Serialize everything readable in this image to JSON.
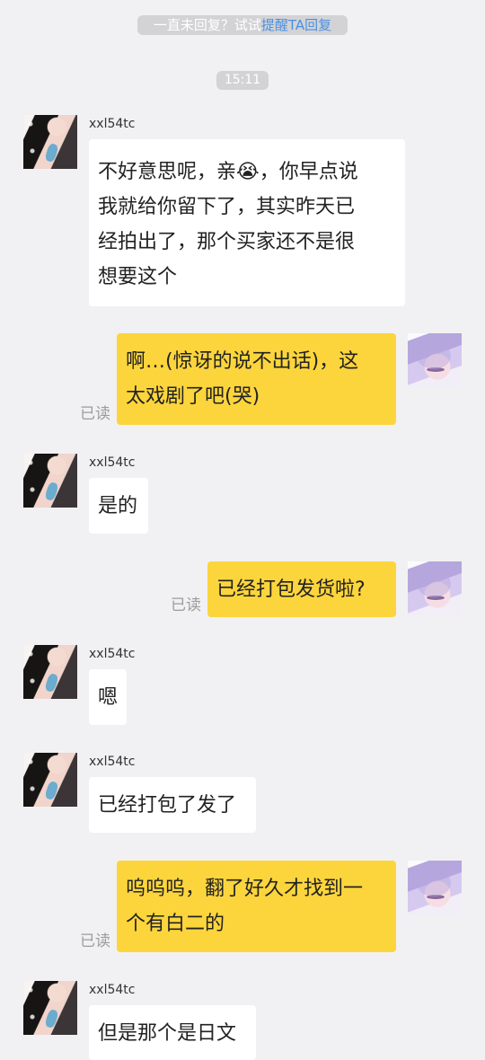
{
  "system": {
    "reminder_prefix": "一直未回复？试试",
    "reminder_link": "提醒TA回复",
    "timestamp": "15:11"
  },
  "contact": {
    "name": "xxl54tc"
  },
  "status": {
    "read": "已读"
  },
  "messages": [
    {
      "side": "left",
      "sender": "xxl54tc",
      "lines": [
        "不好意思呢，亲😭，你早点说",
        "我就给你留下了，其实昨天已",
        "经拍出了，那个买家还不是很",
        "想要这个"
      ]
    },
    {
      "side": "right",
      "read_label": "已读",
      "lines": [
        "啊…(惊讶的说不出话)，这",
        "太戏剧了吧(哭)"
      ]
    },
    {
      "side": "left",
      "sender": "xxl54tc",
      "lines": [
        "是的"
      ]
    },
    {
      "side": "right",
      "read_label": "已读",
      "lines": [
        "已经打包发货啦?"
      ]
    },
    {
      "side": "left",
      "sender": "xxl54tc",
      "lines": [
        "嗯"
      ]
    },
    {
      "side": "left",
      "sender": "xxl54tc",
      "lines": [
        "已经打包了发了"
      ]
    },
    {
      "side": "right",
      "read_label": "已读",
      "lines": [
        "呜呜呜，翻了好久才找到一",
        "个有白二的"
      ]
    },
    {
      "side": "left",
      "sender": "xxl54tc",
      "lines": [
        "但是那个是日文"
      ]
    }
  ],
  "colors": {
    "background": "#f1f1f3",
    "incoming_bubble": "#ffffff",
    "outgoing_bubble": "#fcd53c",
    "system_pill": "#d3d3d6",
    "link": "#4a90e2",
    "read_text": "#9c9c9c"
  }
}
